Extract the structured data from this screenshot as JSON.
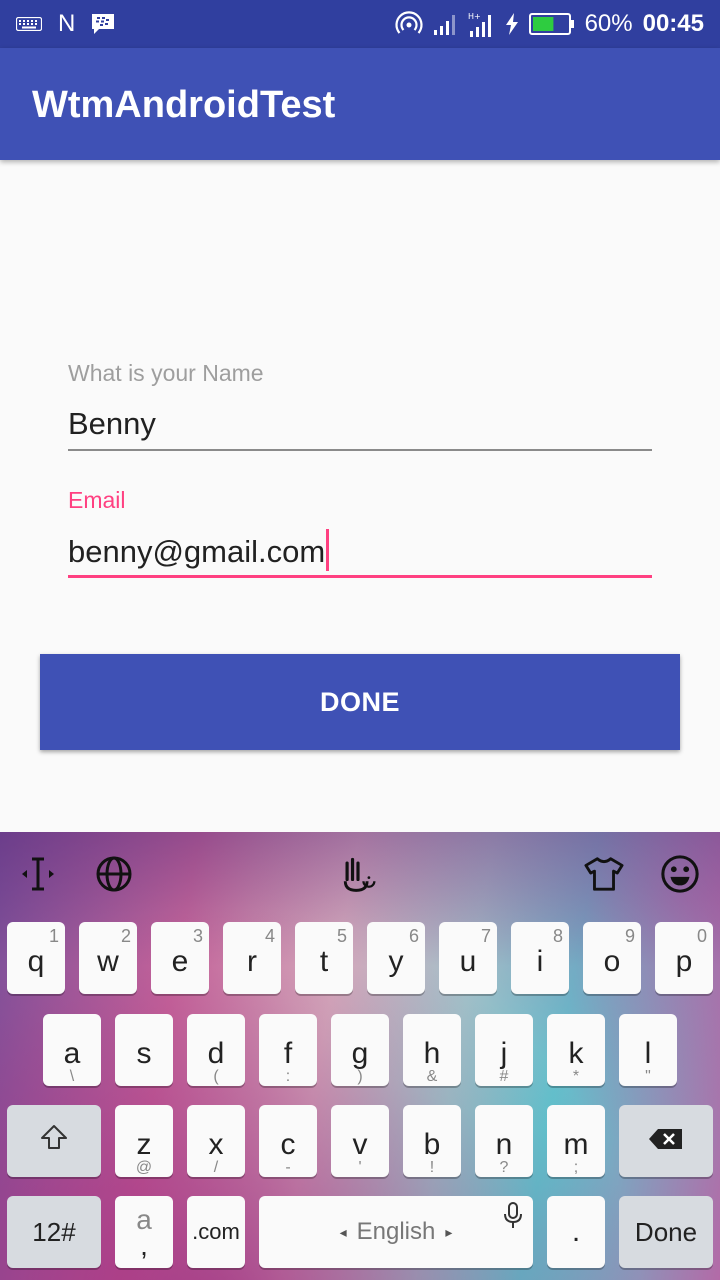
{
  "status_bar": {
    "left_icons": [
      "keyboard-icon",
      "n-notification-icon",
      "bbm-icon"
    ],
    "n_letter": "N",
    "right_icons": [
      "hotspot-icon",
      "signal-icon",
      "signal-ht-icon",
      "charging-icon",
      "battery-icon"
    ],
    "battery": "60%",
    "battery_fraction": 0.6,
    "time": "00:45"
  },
  "app_bar": {
    "title": "WtmAndroidTest"
  },
  "form": {
    "name": {
      "label": "What is your Name",
      "value": "Benny"
    },
    "email": {
      "label": "Email",
      "value": "benny@gmail.com"
    },
    "done_label": "DONE"
  },
  "keyboard": {
    "toolbar_icons": [
      "cursor-move-icon",
      "globe-icon",
      "touchpal-logo-icon",
      "theme-shirt-icon",
      "emoji-icon"
    ],
    "row1": [
      {
        "k": "q",
        "h": "1"
      },
      {
        "k": "w",
        "h": "2"
      },
      {
        "k": "e",
        "h": "3"
      },
      {
        "k": "r",
        "h": "4"
      },
      {
        "k": "t",
        "h": "5"
      },
      {
        "k": "y",
        "h": "6"
      },
      {
        "k": "u",
        "h": "7"
      },
      {
        "k": "i",
        "h": "8"
      },
      {
        "k": "o",
        "h": "9"
      },
      {
        "k": "p",
        "h": "0"
      }
    ],
    "row2": [
      {
        "k": "a",
        "s": "\\"
      },
      {
        "k": "s",
        "s": ""
      },
      {
        "k": "d",
        "s": "("
      },
      {
        "k": "f",
        "s": ":"
      },
      {
        "k": "g",
        "s": ")"
      },
      {
        "k": "h",
        "s": "&"
      },
      {
        "k": "j",
        "s": "#"
      },
      {
        "k": "k",
        "s": "*"
      },
      {
        "k": "l",
        "s": "\""
      }
    ],
    "row3": [
      {
        "k": "z",
        "s": "@"
      },
      {
        "k": "x",
        "s": "/"
      },
      {
        "k": "c",
        "s": "-"
      },
      {
        "k": "v",
        "s": "'"
      },
      {
        "k": "b",
        "s": "!"
      },
      {
        "k": "n",
        "s": "?"
      },
      {
        "k": "m",
        "s": ";"
      }
    ],
    "symbols_key": "12#",
    "comma_key_top": "a",
    "comma_key_bottom": ",",
    "com_key": ".com",
    "space_label": "English",
    "space_left_arrow": "◂",
    "space_right_arrow": "▸",
    "period_key": ".",
    "done_key": "Done"
  }
}
